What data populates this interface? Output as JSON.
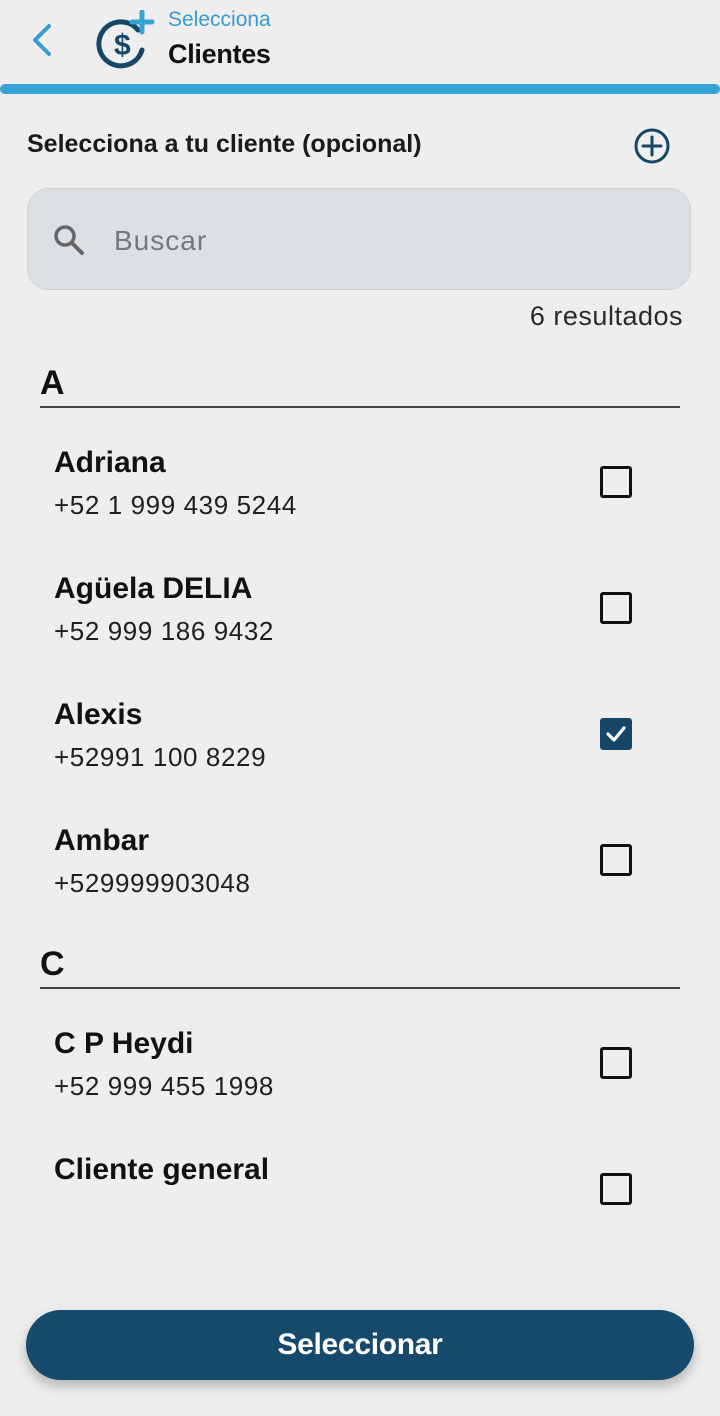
{
  "header": {
    "subtitle": "Selecciona",
    "title": "Clientes",
    "back_icon": "chevron-left-icon",
    "logo_icon": "dollar-plus-icon"
  },
  "colors": {
    "accent": "#36a3d6",
    "primary": "#154a6c",
    "background": "#eeeeee"
  },
  "main": {
    "section_label": "Selecciona a tu cliente (opcional)",
    "add_icon": "plus-circle-icon",
    "search": {
      "placeholder": "Buscar",
      "value": "",
      "icon": "search-icon"
    },
    "results_count": "6 resultados",
    "groups": [
      {
        "letter": "A",
        "clients": [
          {
            "name": "Adriana",
            "phone": "+52 1 999 439 5244",
            "checked": false
          },
          {
            "name": "Agüela DELIA",
            "phone": "+52 999 186 9432",
            "checked": false
          },
          {
            "name": "Alexis",
            "phone": "+52991 100 8229",
            "checked": true
          },
          {
            "name": "Ambar",
            "phone": "+529999903048",
            "checked": false
          }
        ]
      },
      {
        "letter": "C",
        "clients": [
          {
            "name": "C P Heydi",
            "phone": "+52 999 455 1998",
            "checked": false
          },
          {
            "name": "Cliente general",
            "phone": "",
            "checked": false
          }
        ]
      }
    ]
  },
  "footer": {
    "select_label": "Seleccionar"
  }
}
